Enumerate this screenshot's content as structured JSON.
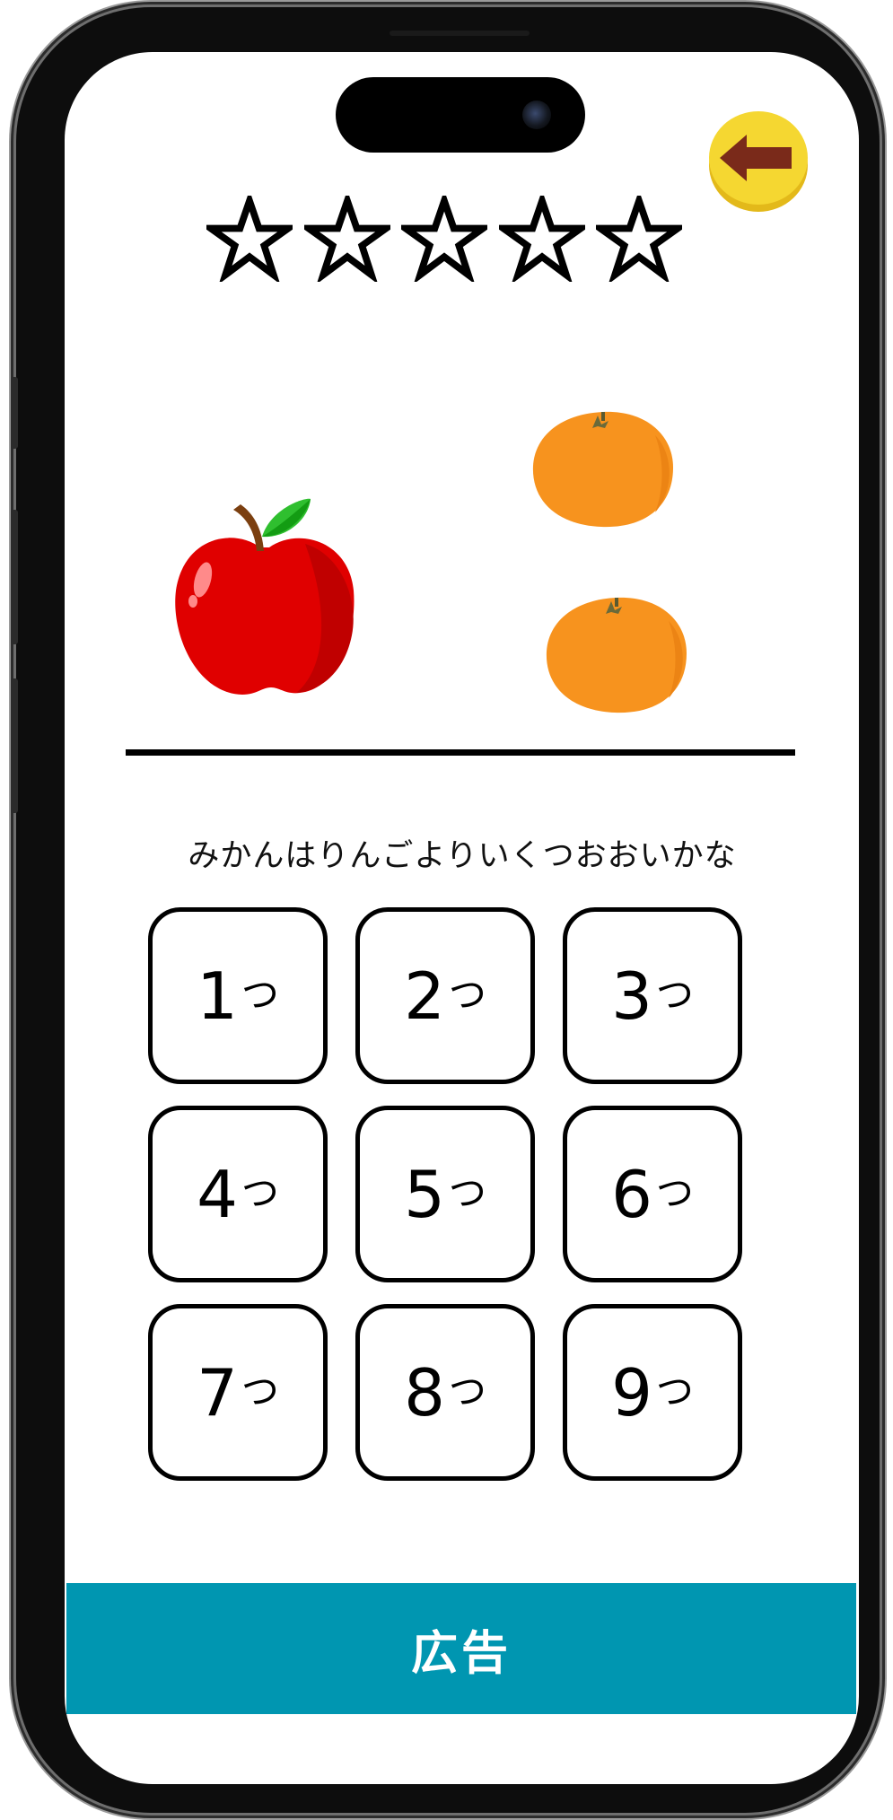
{
  "stars": {
    "total": 5,
    "filled": 0
  },
  "fruits": {
    "left": {
      "name": "apple",
      "count": 1
    },
    "right": {
      "name": "mandarin-orange",
      "count": 2
    }
  },
  "question": {
    "text": "みかんはりんごよりいくつおおいかな"
  },
  "answers": [
    {
      "number": "1",
      "unit": "つ"
    },
    {
      "number": "2",
      "unit": "つ"
    },
    {
      "number": "3",
      "unit": "つ"
    },
    {
      "number": "4",
      "unit": "つ"
    },
    {
      "number": "5",
      "unit": "つ"
    },
    {
      "number": "6",
      "unit": "つ"
    },
    {
      "number": "7",
      "unit": "つ"
    },
    {
      "number": "8",
      "unit": "つ"
    },
    {
      "number": "9",
      "unit": "つ"
    }
  ],
  "ad": {
    "label": "広告"
  },
  "colors": {
    "back_button": "#f5d731",
    "back_arrow": "#7a2a1a",
    "ad_banner": "#0096b1",
    "apple": "#ff0000",
    "orange": "#f7931e"
  },
  "icons": {
    "back": "arrow-left-icon",
    "star": "star-outline-icon"
  }
}
